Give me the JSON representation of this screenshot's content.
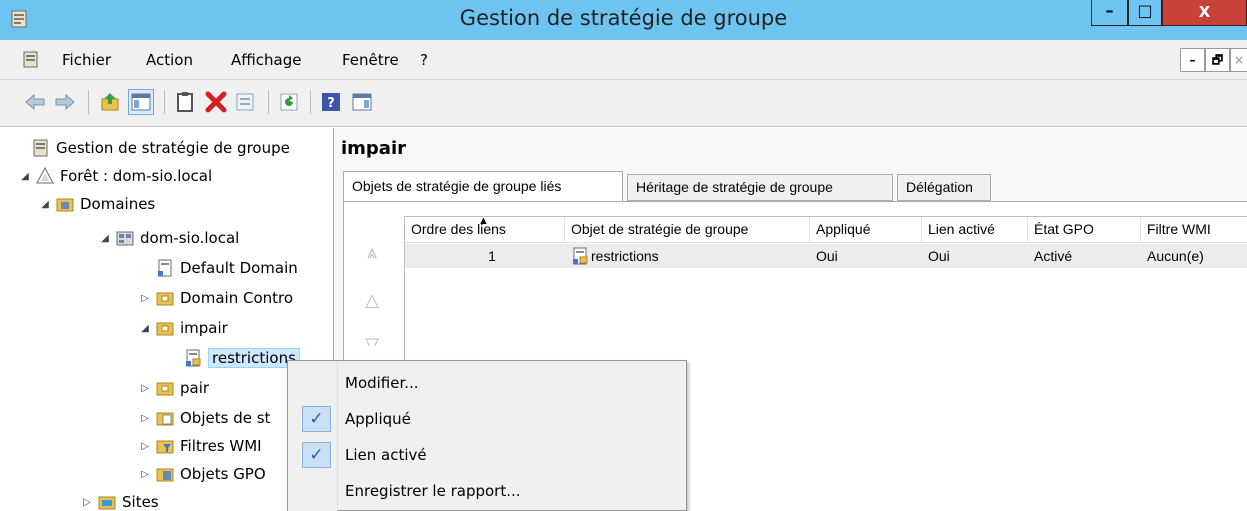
{
  "window": {
    "title": "Gestion de stratégie de groupe",
    "min_glyph": "–",
    "max_glyph": "□",
    "close_glyph": "X"
  },
  "menubar": {
    "items": [
      "Fichier",
      "Action",
      "Affichage",
      "Fenêtre",
      "?"
    ],
    "mdi_min": "–",
    "mdi_restore": "🗗",
    "mdi_close": "×"
  },
  "toolbar": {
    "icons": [
      "back-arrow-icon",
      "forward-arrow-icon",
      "up-folder-icon",
      "show-hide-tree-icon",
      "clipboard-icon",
      "delete-icon",
      "properties-icon",
      "refresh-icon",
      "help-icon",
      "show-action-pane-icon"
    ]
  },
  "tree": {
    "root": "Gestion de stratégie de groupe",
    "forest": "Forêt : dom-sio.local",
    "domains": "Domaines",
    "domain": "dom-sio.local",
    "default_domain": "Default Domain",
    "domain_controllers": "Domain Contro",
    "impair": "impair",
    "restrictions": "restrictions",
    "pair": "pair",
    "gpo_objects": "Objets de st",
    "wmi_filters": "Filtres WMI",
    "starter_gpo": "Objets GPO",
    "sites": "Sites"
  },
  "main": {
    "heading": "impair",
    "tabs": [
      "Objets de stratégie de groupe liés",
      "Héritage de stratégie de groupe",
      "Délégation"
    ],
    "columns": [
      "Ordre des liens",
      "Objet de stratégie de groupe",
      "Appliqué",
      "Lien activé",
      "État GPO",
      "Filtre WMI"
    ],
    "rows": [
      {
        "order": "1",
        "gpo": "restrictions",
        "enforced": "Oui",
        "link_enabled": "Oui",
        "status": "Activé",
        "wmi": "Aucun(e)"
      }
    ]
  },
  "context_menu": {
    "items": [
      {
        "label": "Modifier...",
        "checked": false
      },
      {
        "label": "Appliqué",
        "checked": true
      },
      {
        "label": "Lien activé",
        "checked": true
      },
      {
        "label": "Enregistrer le rapport...",
        "checked": false
      }
    ],
    "check_glyph": "✓"
  },
  "colors": {
    "titlebar": "#6ec4f0",
    "close": "#c7433a",
    "selection": "#cde8ff"
  }
}
